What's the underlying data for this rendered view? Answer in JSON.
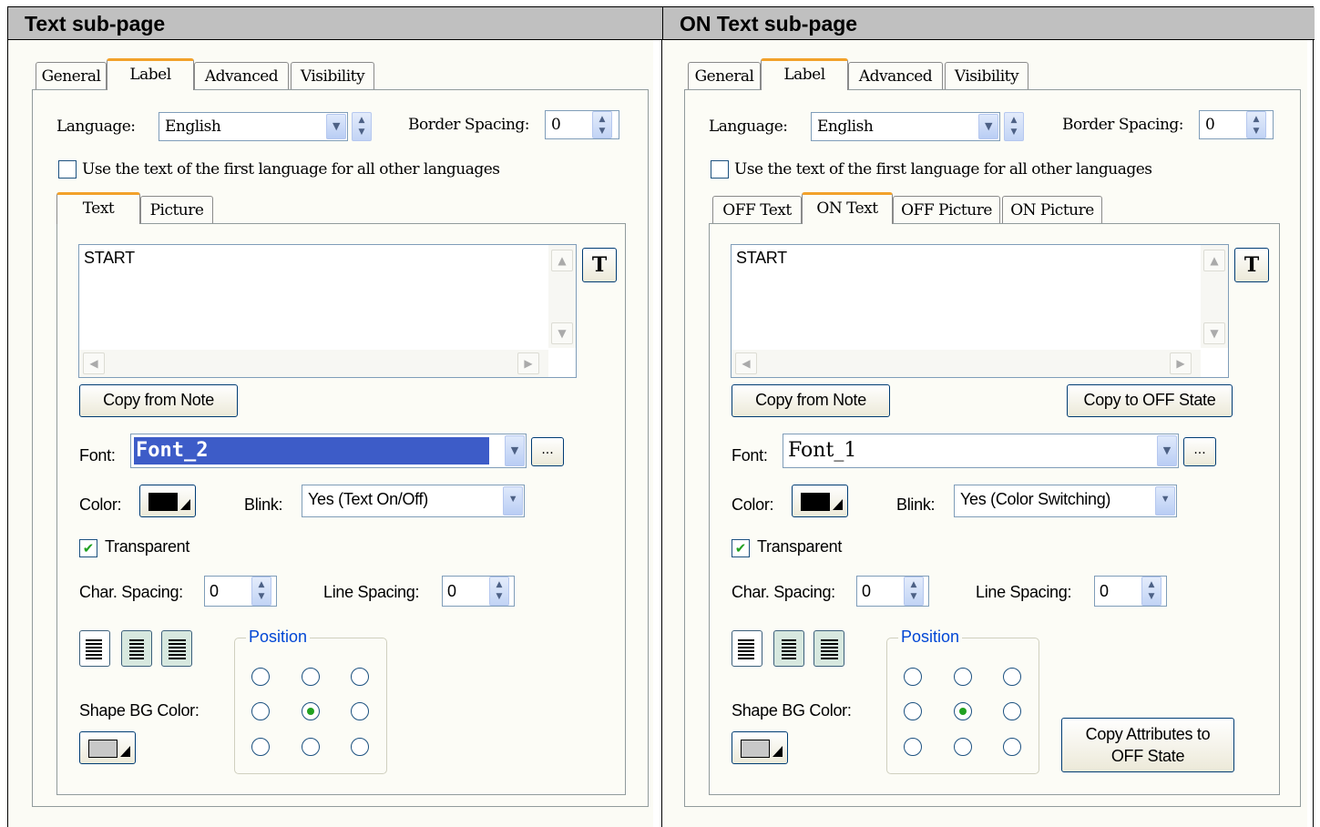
{
  "headers": [
    "Text sub-page",
    "ON Text sub-page"
  ],
  "panels": [
    {
      "main_tabs": [
        "General",
        "Label",
        "Advanced",
        "Visibility"
      ],
      "language_label": "Language:",
      "language_value": "English",
      "border_spacing_label": "Border Spacing:",
      "border_spacing_value": "0",
      "use_first_language_label": "Use the text of the first language for all other languages",
      "use_first_language_checked": false,
      "sub_tabs": [
        "Text",
        "Picture"
      ],
      "text_value": "START",
      "text_style_button": "T",
      "copy_from_note": "Copy from Note",
      "font_label": "Font:",
      "font_value": "Font_2",
      "ellipsis": "...",
      "color_label": "Color:",
      "blink_label": "Blink:",
      "blink_value": "Yes (Text On/Off)",
      "transparent_label": "Transparent",
      "transparent_checked": true,
      "char_spacing_label": "Char. Spacing:",
      "char_spacing_value": "0",
      "line_spacing_label": "Line Spacing:",
      "line_spacing_value": "0",
      "position_label": "Position",
      "position_selected": "center",
      "shape_bg_label": "Shape BG Color:"
    },
    {
      "main_tabs": [
        "General",
        "Label",
        "Advanced",
        "Visibility"
      ],
      "language_label": "Language:",
      "language_value": "English",
      "border_spacing_label": "Border Spacing:",
      "border_spacing_value": "0",
      "use_first_language_label": "Use the text of the first language for all other languages",
      "use_first_language_checked": false,
      "sub_tabs": [
        "OFF Text",
        "ON Text",
        "OFF Picture",
        "ON Picture"
      ],
      "text_value": "START",
      "text_style_button": "T",
      "copy_from_note": "Copy from Note",
      "copy_to_off": "Copy to OFF State",
      "font_label": "Font:",
      "font_value": "Font_1",
      "ellipsis": "...",
      "color_label": "Color:",
      "blink_label": "Blink:",
      "blink_value": "Yes (Color Switching)",
      "transparent_label": "Transparent",
      "transparent_checked": true,
      "char_spacing_label": "Char. Spacing:",
      "char_spacing_value": "0",
      "line_spacing_label": "Line Spacing:",
      "line_spacing_value": "0",
      "position_label": "Position",
      "position_selected": "center",
      "shape_bg_label": "Shape BG Color:",
      "copy_attributes_line1": "Copy Attributes to",
      "copy_attributes_line2": "OFF State"
    }
  ],
  "colors": {
    "text_color": "#000000",
    "shape_bg_color": "#c8c8c8",
    "tab_highlight": "#f2a12a",
    "font_selection": "#3d5cc8"
  }
}
